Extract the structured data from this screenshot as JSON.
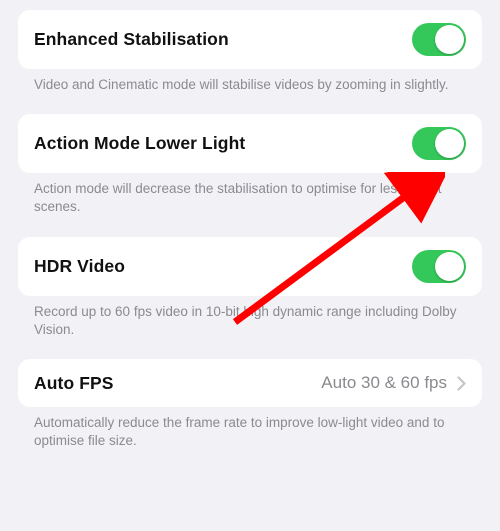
{
  "colors": {
    "toggle_on": "#34c759",
    "arrow": "#ff0000"
  },
  "settings": {
    "stabilisation": {
      "title": "Enhanced Stabilisation",
      "on": true,
      "footer": "Video and Cinematic mode will stabilise videos by zooming in slightly."
    },
    "action_mode": {
      "title": "Action Mode Lower Light",
      "on": true,
      "footer": "Action mode will decrease the stabilisation to optimise for less bright scenes."
    },
    "hdr": {
      "title": "HDR Video",
      "on": true,
      "footer": "Record up to 60 fps video in 10-bit high dynamic range including Dolby Vision."
    },
    "auto_fps": {
      "title": "Auto FPS",
      "value": "Auto 30 & 60 fps",
      "footer": "Automatically reduce the frame rate to improve low-light video and to optimise file size."
    }
  }
}
